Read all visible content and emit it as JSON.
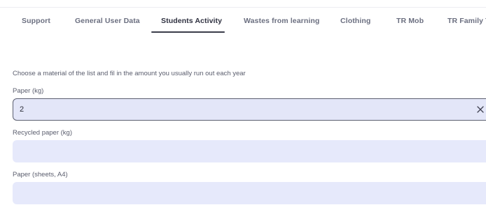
{
  "tabs": [
    {
      "label": "Support"
    },
    {
      "label": "General User Data"
    },
    {
      "label": "Students Activity",
      "active": true
    },
    {
      "label": "Wastes from learning"
    },
    {
      "label": "Clothing"
    },
    {
      "label": "TR Mob"
    },
    {
      "label": "TR Family Tr"
    }
  ],
  "form": {
    "instruction": "Choose a material of the list and fil in the amount you usually run out each year",
    "fields": [
      {
        "label": "Paper (kg)",
        "value": "2",
        "placeholder": ""
      },
      {
        "label": "Recycled paper (kg)",
        "value": "",
        "placeholder": ""
      },
      {
        "label": "Paper (sheets, A4)",
        "value": "",
        "placeholder": ""
      }
    ]
  },
  "icons": {
    "clear": "close-icon"
  },
  "colors": {
    "field_background": "#e6e9fb",
    "active_tab_underline": "#3a3c4a"
  }
}
